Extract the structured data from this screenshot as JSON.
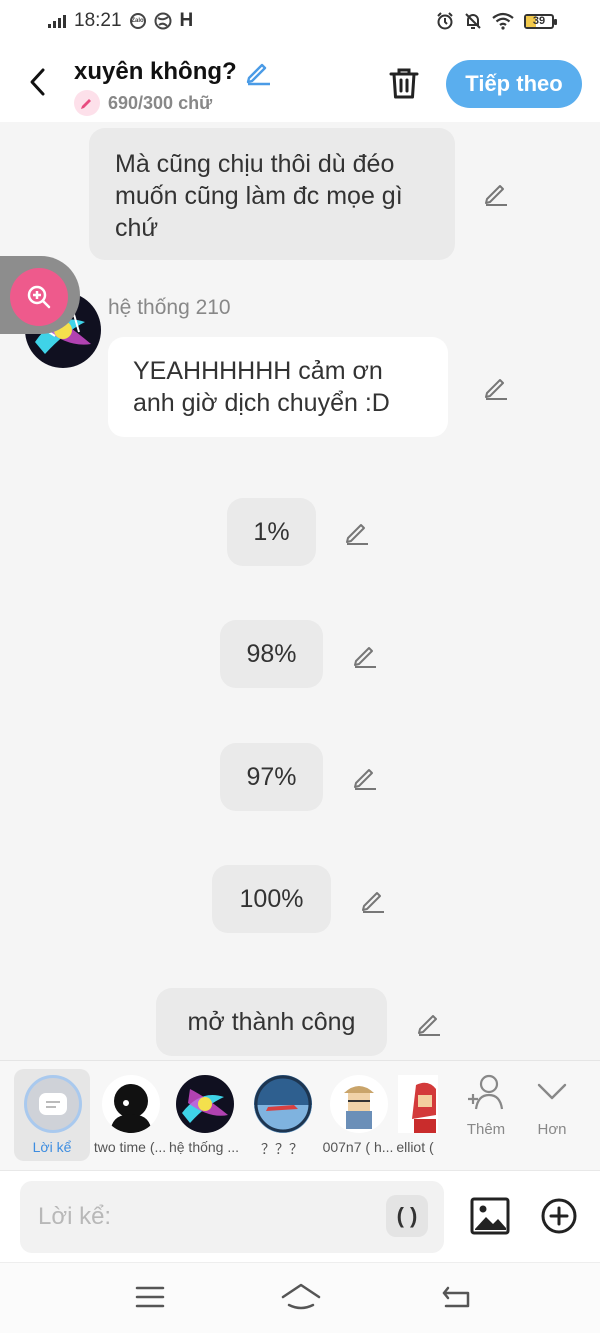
{
  "status_bar": {
    "time": "18:21",
    "battery": "39",
    "battery_fraction": 0.39
  },
  "header": {
    "title": "xuyên không?",
    "counter": "690/300 chữ",
    "next_label": "Tiếp theo"
  },
  "messages": [
    {
      "text": "Mà cũng chịu thôi dù đéo muốn cũng làm đc mọe gì chứ"
    },
    {
      "sender": "hệ thống 210",
      "text": "YEAHHHHHH cảm ơn anh giờ dịch chuyển :D"
    },
    {
      "text": "1%"
    },
    {
      "text": "98%"
    },
    {
      "text": "97%"
    },
    {
      "text": "100%"
    },
    {
      "text": "mở thành công"
    }
  ],
  "characters": [
    {
      "name": "Lời kể",
      "selected": true
    },
    {
      "name": "two time (..."
    },
    {
      "name": "hệ thống ..."
    },
    {
      "name": "？？？"
    },
    {
      "name": "007n7 ( h..."
    },
    {
      "name": "elliot ("
    }
  ],
  "actions": {
    "add_label": "Thêm",
    "more_label": "Hơn"
  },
  "input": {
    "placeholder": "Lời kể:",
    "emoji_label": "( )"
  },
  "colors": {
    "accent": "#5aaeee",
    "pink": "#ee5a8c"
  }
}
